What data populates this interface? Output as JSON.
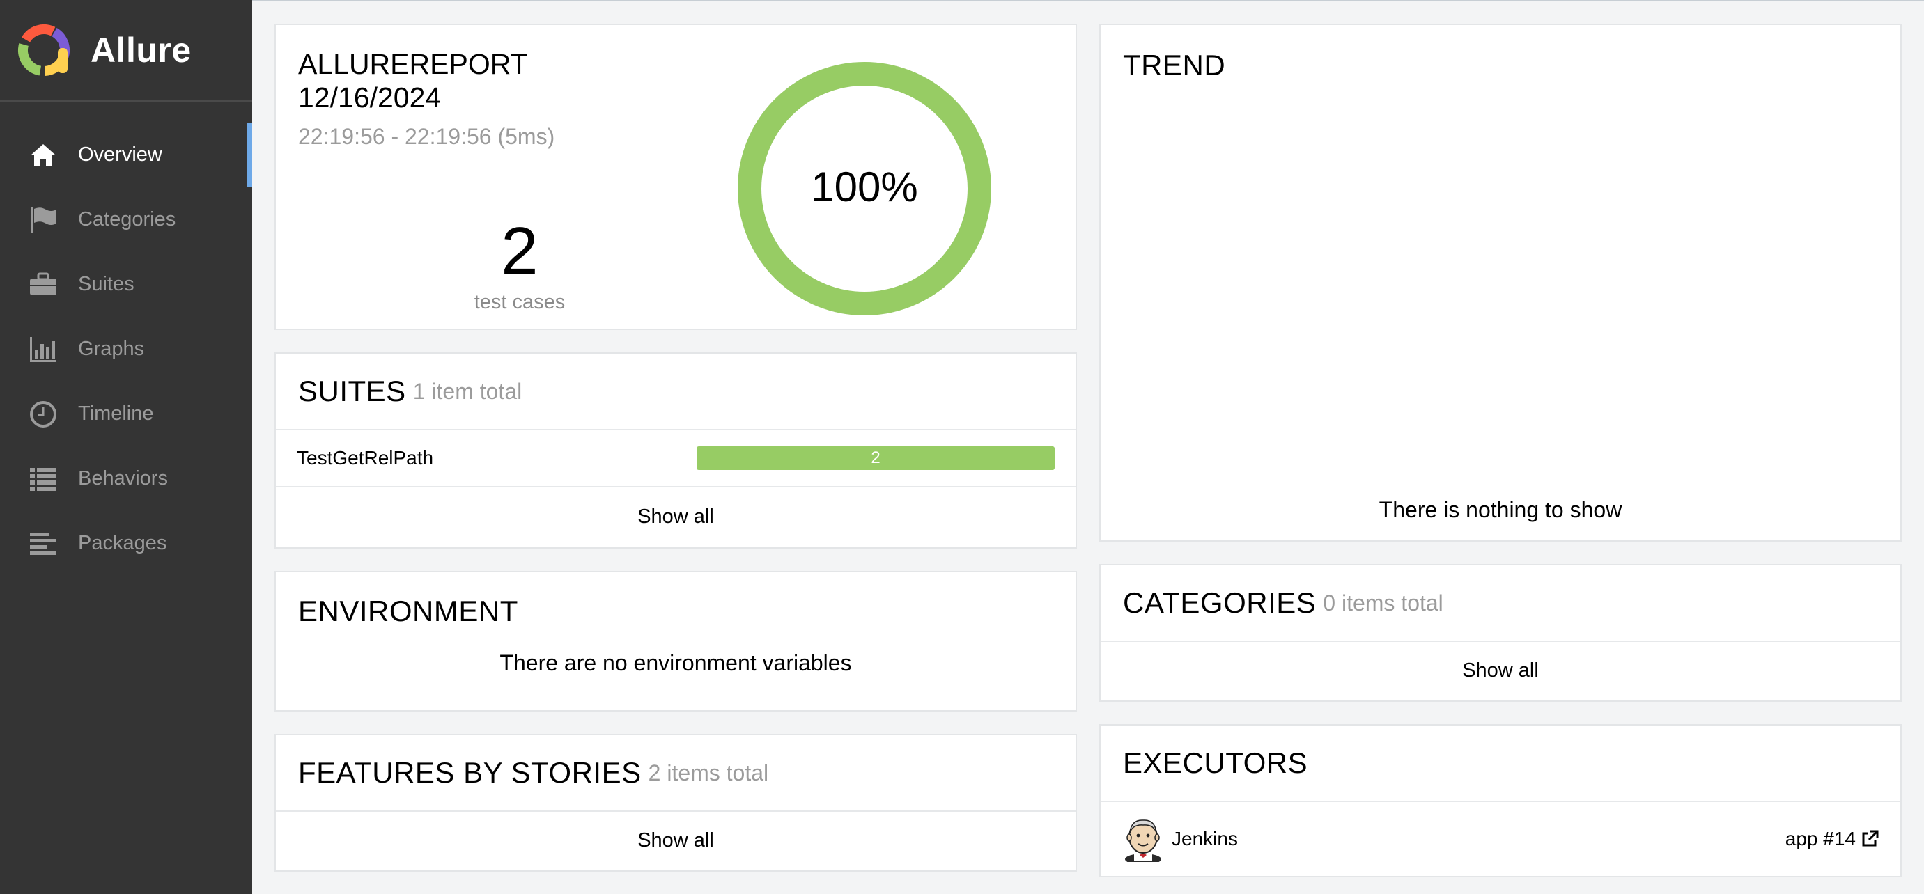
{
  "app": {
    "name": "Allure"
  },
  "sidebar": {
    "items": [
      {
        "label": "Overview",
        "icon": "home-icon",
        "active": true
      },
      {
        "label": "Categories",
        "icon": "flag-icon"
      },
      {
        "label": "Suites",
        "icon": "briefcase-icon"
      },
      {
        "label": "Graphs",
        "icon": "bar-chart-icon"
      },
      {
        "label": "Timeline",
        "icon": "clock-icon"
      },
      {
        "label": "Behaviors",
        "icon": "list-icon"
      },
      {
        "label": "Packages",
        "icon": "align-left-icon"
      }
    ]
  },
  "summary": {
    "title_line1": "ALLUREREPORT",
    "title_line2": "12/16/2024",
    "time_range": "22:19:56 - 22:19:56 (5ms)",
    "count": "2",
    "count_label": "test cases",
    "percent": "100%",
    "pass_fraction": 1.0,
    "pass_color": "#97cc64"
  },
  "suites": {
    "title": "SUITES",
    "subtitle": "1 item total",
    "rows": [
      {
        "name": "TestGetRelPath",
        "passed": "2"
      }
    ],
    "show_all": "Show all"
  },
  "environment": {
    "title": "ENVIRONMENT",
    "message": "There are no environment variables"
  },
  "features": {
    "title": "FEATURES BY STORIES",
    "subtitle": "2 items total",
    "show_all": "Show all"
  },
  "trend": {
    "title": "TREND",
    "message": "There is nothing to show"
  },
  "categories": {
    "title": "CATEGORIES",
    "subtitle": "0 items total",
    "show_all": "Show all"
  },
  "executors": {
    "title": "EXECUTORS",
    "rows": [
      {
        "name": "Jenkins",
        "build": "app #14",
        "avatar": "jenkins-avatar-icon"
      }
    ]
  },
  "colors": {
    "sidebar_bg": "#343434",
    "active_marker": "#6ea9e8",
    "passed": "#97cc64"
  }
}
